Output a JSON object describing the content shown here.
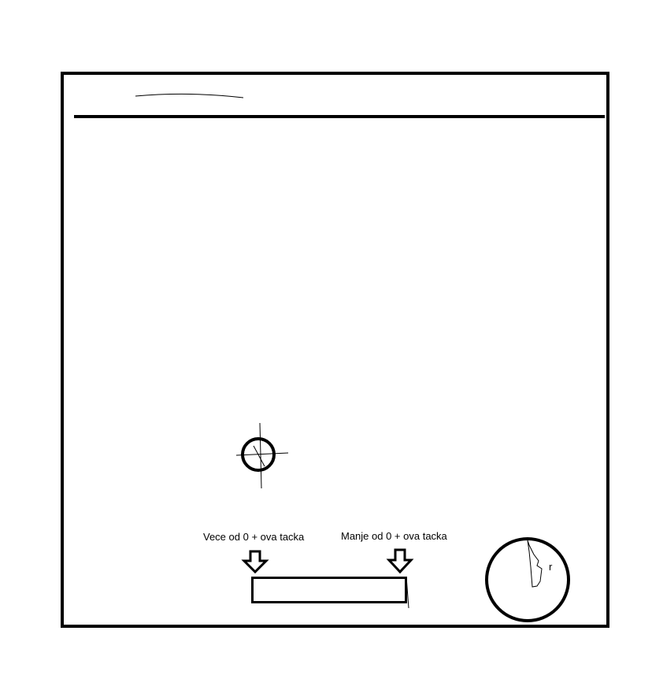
{
  "labels": {
    "greater": "Vece od 0 + ova tacka",
    "less": "Manje od 0 + ova tacka"
  },
  "joystick": {
    "radius_label": "r"
  },
  "icons": {
    "crosshair": "crosshair-icon",
    "arrow_down": "arrow-down-icon",
    "joystick": "joystick-circle-icon"
  },
  "colors": {
    "ink": "#000000",
    "background": "#ffffff"
  }
}
